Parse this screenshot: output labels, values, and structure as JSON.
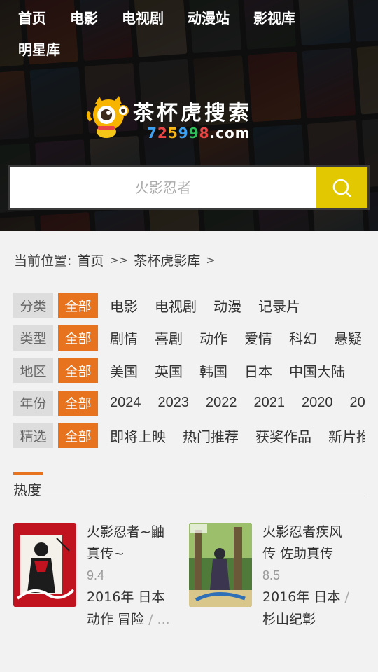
{
  "nav": {
    "items": [
      "首页",
      "电影",
      "电视剧",
      "动漫站",
      "影视库",
      "明星库"
    ]
  },
  "logo": {
    "title": "茶杯虎搜索",
    "url_digits": [
      "7",
      "2",
      "5",
      "9",
      "9",
      "8"
    ],
    "url_domain": ".com"
  },
  "search": {
    "placeholder": "火影忍者"
  },
  "breadcrumb": {
    "prefix": "当前位置:",
    "home": "首页",
    "sep1": ">>",
    "current": "茶杯虎影库",
    "sep2": ">"
  },
  "filters": [
    {
      "label": "分类",
      "all": "全部",
      "options": [
        "电影",
        "电视剧",
        "动漫",
        "记录片"
      ]
    },
    {
      "label": "类型",
      "all": "全部",
      "options": [
        "剧情",
        "喜剧",
        "动作",
        "爱情",
        "科幻",
        "悬疑"
      ]
    },
    {
      "label": "地区",
      "all": "全部",
      "options": [
        "美国",
        "英国",
        "韩国",
        "日本",
        "中国大陆"
      ]
    },
    {
      "label": "年份",
      "all": "全部",
      "options": [
        "2024",
        "2023",
        "2022",
        "2021",
        "2020",
        "20"
      ]
    },
    {
      "label": "精选",
      "all": "全部",
      "options": [
        "即将上映",
        "热门推荐",
        "获奖作品",
        "新片推"
      ]
    }
  ],
  "hot": {
    "title": "热度",
    "items": [
      {
        "name": "火影忍者~鼬真传~",
        "score": "9.4",
        "meta_line1": "2016年 日本",
        "meta_line2": "动作 冒险",
        "meta_tail": "/ ...",
        "poster_colors": [
          "#c1121f",
          "#f4f0ea",
          "#1c1c1c"
        ]
      },
      {
        "name": "火影忍者疾风传 佐助真传",
        "score": "8.5",
        "meta_line1": "2016年 日本",
        "meta_tail": "/",
        "meta_line2": "杉山纪彰",
        "poster_colors": [
          "#4f7a3a",
          "#9bbf6a",
          "#d9c68a"
        ]
      }
    ]
  },
  "colors": {
    "accent": "#e8731e",
    "search_button": "#e2c800",
    "header_bg": "#1b1b1d"
  }
}
